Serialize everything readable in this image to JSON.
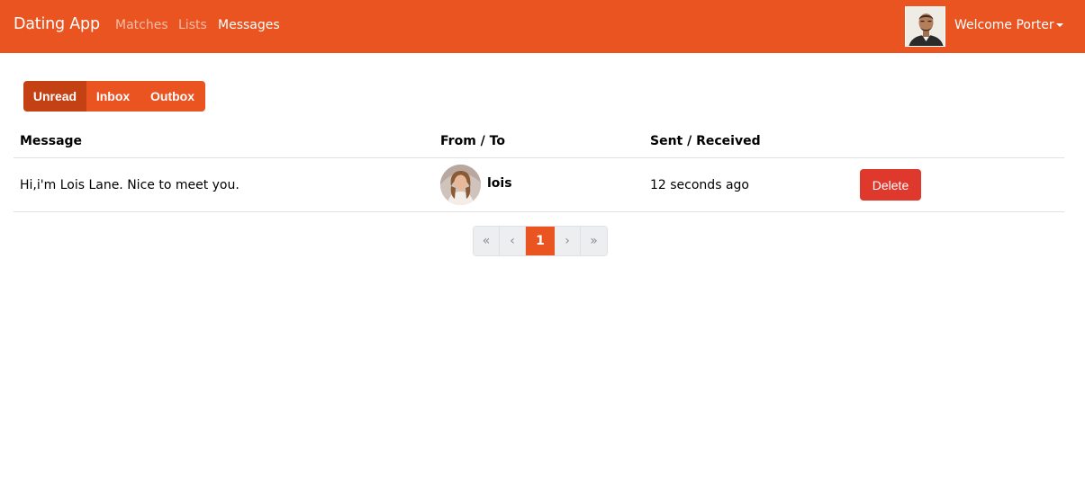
{
  "navbar": {
    "brand": "Dating App",
    "links": [
      {
        "label": "Matches",
        "active": false
      },
      {
        "label": "Lists",
        "active": false
      },
      {
        "label": "Messages",
        "active": true
      }
    ],
    "welcome": "Welcome Porter",
    "accent_color": "#e95420"
  },
  "tabs": {
    "items": [
      "Unread",
      "Inbox",
      "Outbox"
    ],
    "selected": "Unread"
  },
  "table": {
    "headers": [
      "Message",
      "From / To",
      "Sent / Received"
    ],
    "rows": [
      {
        "message": "Hi,i'm Lois Lane. Nice to meet you.",
        "sender": "lois",
        "time": "12 seconds ago",
        "action": "Delete"
      }
    ]
  },
  "pagination": {
    "first": "«",
    "prev": "‹",
    "current": "1",
    "next": "›",
    "last": "»"
  },
  "colors": {
    "primary": "#e95420",
    "primary_active": "#c34113",
    "danger": "#df382c"
  }
}
